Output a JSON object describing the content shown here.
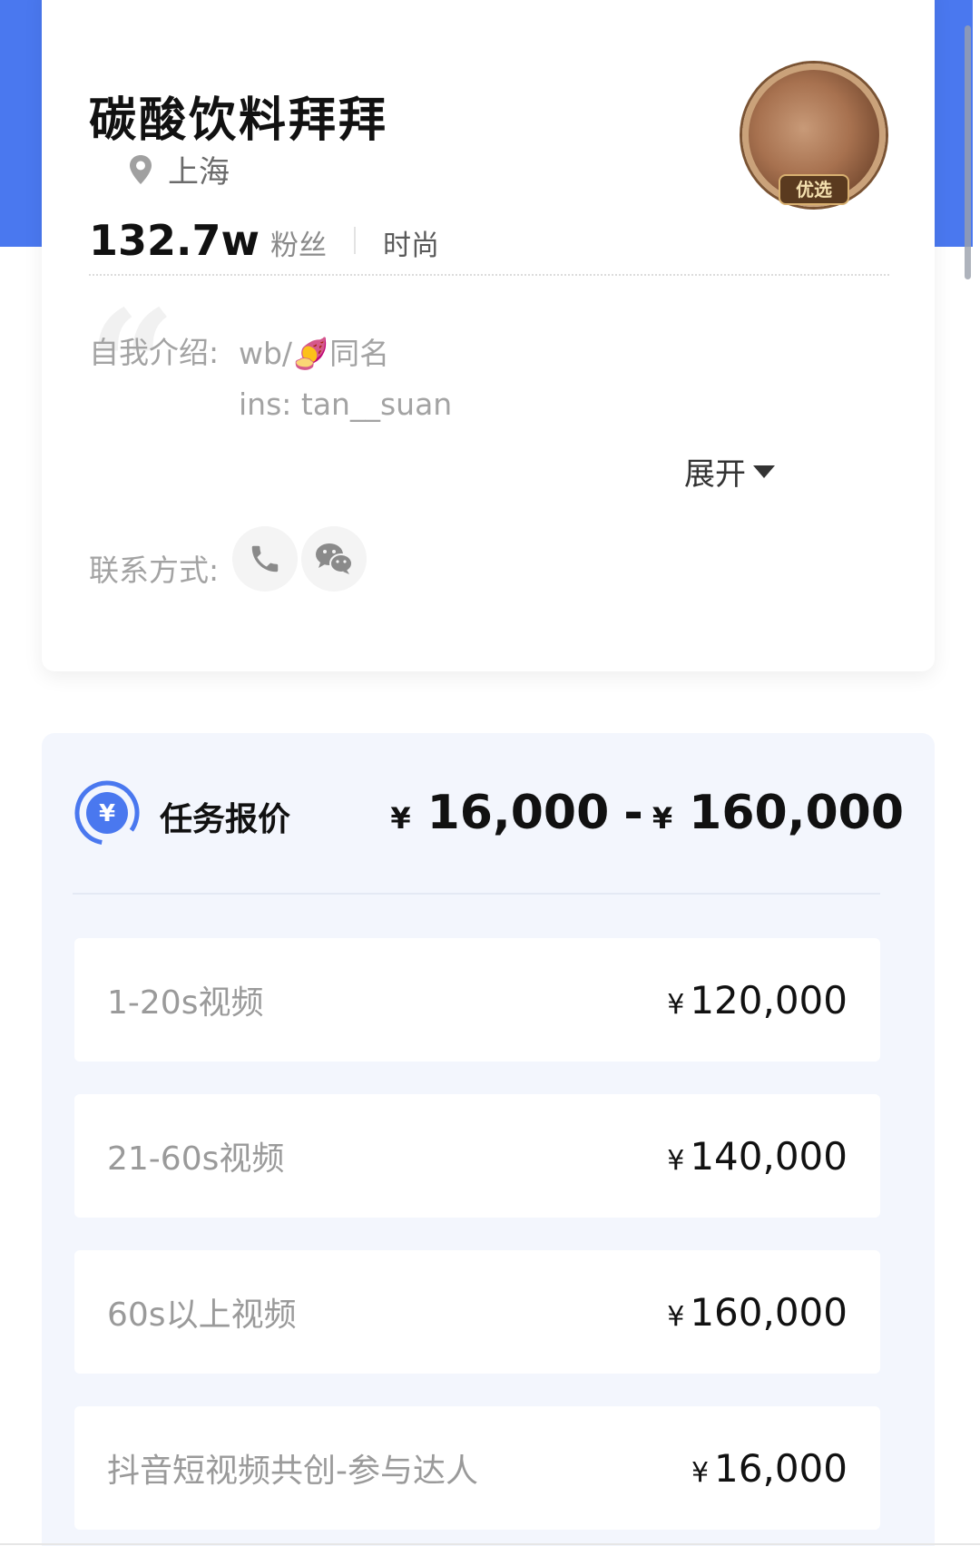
{
  "profile": {
    "name": "碳酸饮料拜拜",
    "location": "上海",
    "fans_count": "132.7w",
    "fans_label": "粉丝",
    "category": "时尚",
    "avatar_badge": "优选",
    "intro_label": "自我介绍:",
    "intro_line1_prefix": "wb/",
    "intro_emoji": "🍠",
    "intro_line1_suffix": "同名",
    "intro_line2": "ins: tan__suan",
    "expand_label": "展开",
    "contact_label": "联系方式:"
  },
  "quote": {
    "title": "任务报价",
    "yen": "¥",
    "min": "16,000",
    "range_separator": "-",
    "max": "160,000",
    "items": [
      {
        "label": "1-20s视频",
        "yen": "¥",
        "price": "120,000"
      },
      {
        "label": "21-60s视频",
        "yen": "¥",
        "price": "140,000"
      },
      {
        "label": "60s以上视频",
        "yen": "¥",
        "price": "160,000"
      },
      {
        "label": "抖音短视频共创-参与达人",
        "yen": "¥",
        "price": "16,000"
      }
    ]
  },
  "colors": {
    "accent_blue": "#4a78ef",
    "card_bg_blue": "#f3f6fd"
  },
  "icons": [
    "location-pin-icon",
    "phone-icon",
    "wechat-icon",
    "yen-coin-icon",
    "expand-triangle-icon"
  ]
}
